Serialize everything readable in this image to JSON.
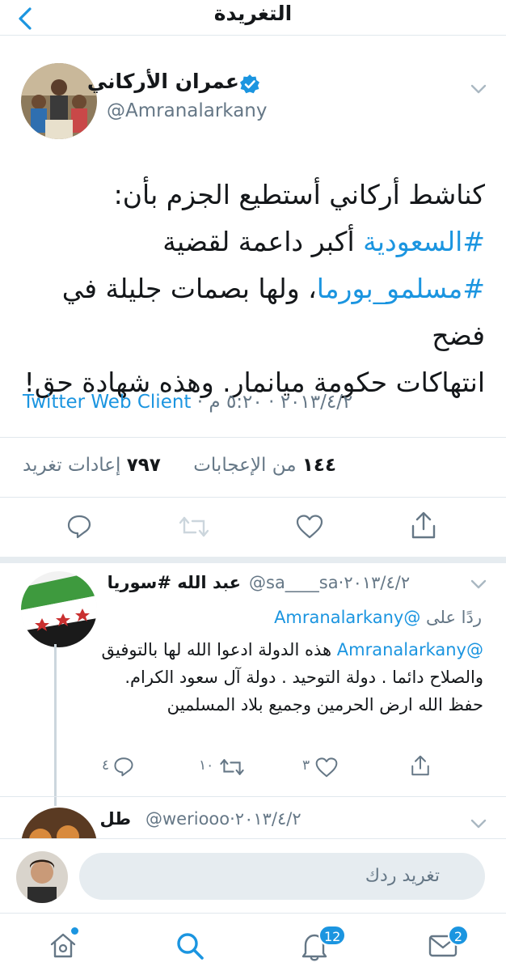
{
  "header": {
    "title": "التغريدة"
  },
  "colors": {
    "accent": "#1b95e0",
    "muted": "#657786",
    "divider": "#e1e8ed"
  },
  "main_tweet": {
    "name": "عمران الأركاني",
    "handle": "@Amranalarkany",
    "verified": true,
    "text_lines": [
      {
        "plain": "كناشط أركاني أستطيع الجزم بأن:"
      },
      {
        "tag": "#السعودية",
        "rest": " أكبر داعمة لقضية"
      },
      {
        "tag": "#مسلمو_بورما",
        "rest": "، ولها بصمات جليلة في فضح"
      },
      {
        "plain": "انتهاكات حكومة ميانمار. وهذه شهادة حق!"
      }
    ],
    "time": "٥:٢٠ م",
    "date": "٢٠١٣/٤/٢",
    "client": "Twitter Web Client",
    "separator": "·",
    "likes_count": "١٤٤",
    "likes_label": "من الإعجابات",
    "retweets_count": "٧٩٧",
    "retweets_label": "إعادات تغريد"
  },
  "replies": [
    {
      "name": "عبد الله #سوريا",
      "handle": "@sa____sa",
      "date": "٢٠١٣/٤/٢",
      "separator": "·",
      "replying_to_label": "ردًا على",
      "replying_to_handle": "@Amranalarkany",
      "mention": "@Amranalarkany",
      "text": "هذه الدولة ادعوا الله لها بالتوفيق والصلاح دائما . دولة التوحيد . دولة آل سعود الكرام. حفظ الله ارض الحرمين وجميع بلاد المسلمين",
      "reply_count": "٤",
      "retweet_count": "١٠",
      "like_count": "٣"
    },
    {
      "name": "طل",
      "handle": "@weriooo",
      "date": "٢٠١٣/٤/٢",
      "separator": "·"
    }
  ],
  "compose": {
    "placeholder": "تغريد ردك"
  },
  "tabbar": {
    "notifications_badge": "12",
    "messages_badge": "2"
  },
  "icons": [
    "back-chevron-icon",
    "verified-badge-icon",
    "caret-down-icon",
    "reply-icon",
    "retweet-icon",
    "like-icon",
    "share-icon",
    "home-icon",
    "search-icon",
    "notifications-icon",
    "messages-icon"
  ]
}
